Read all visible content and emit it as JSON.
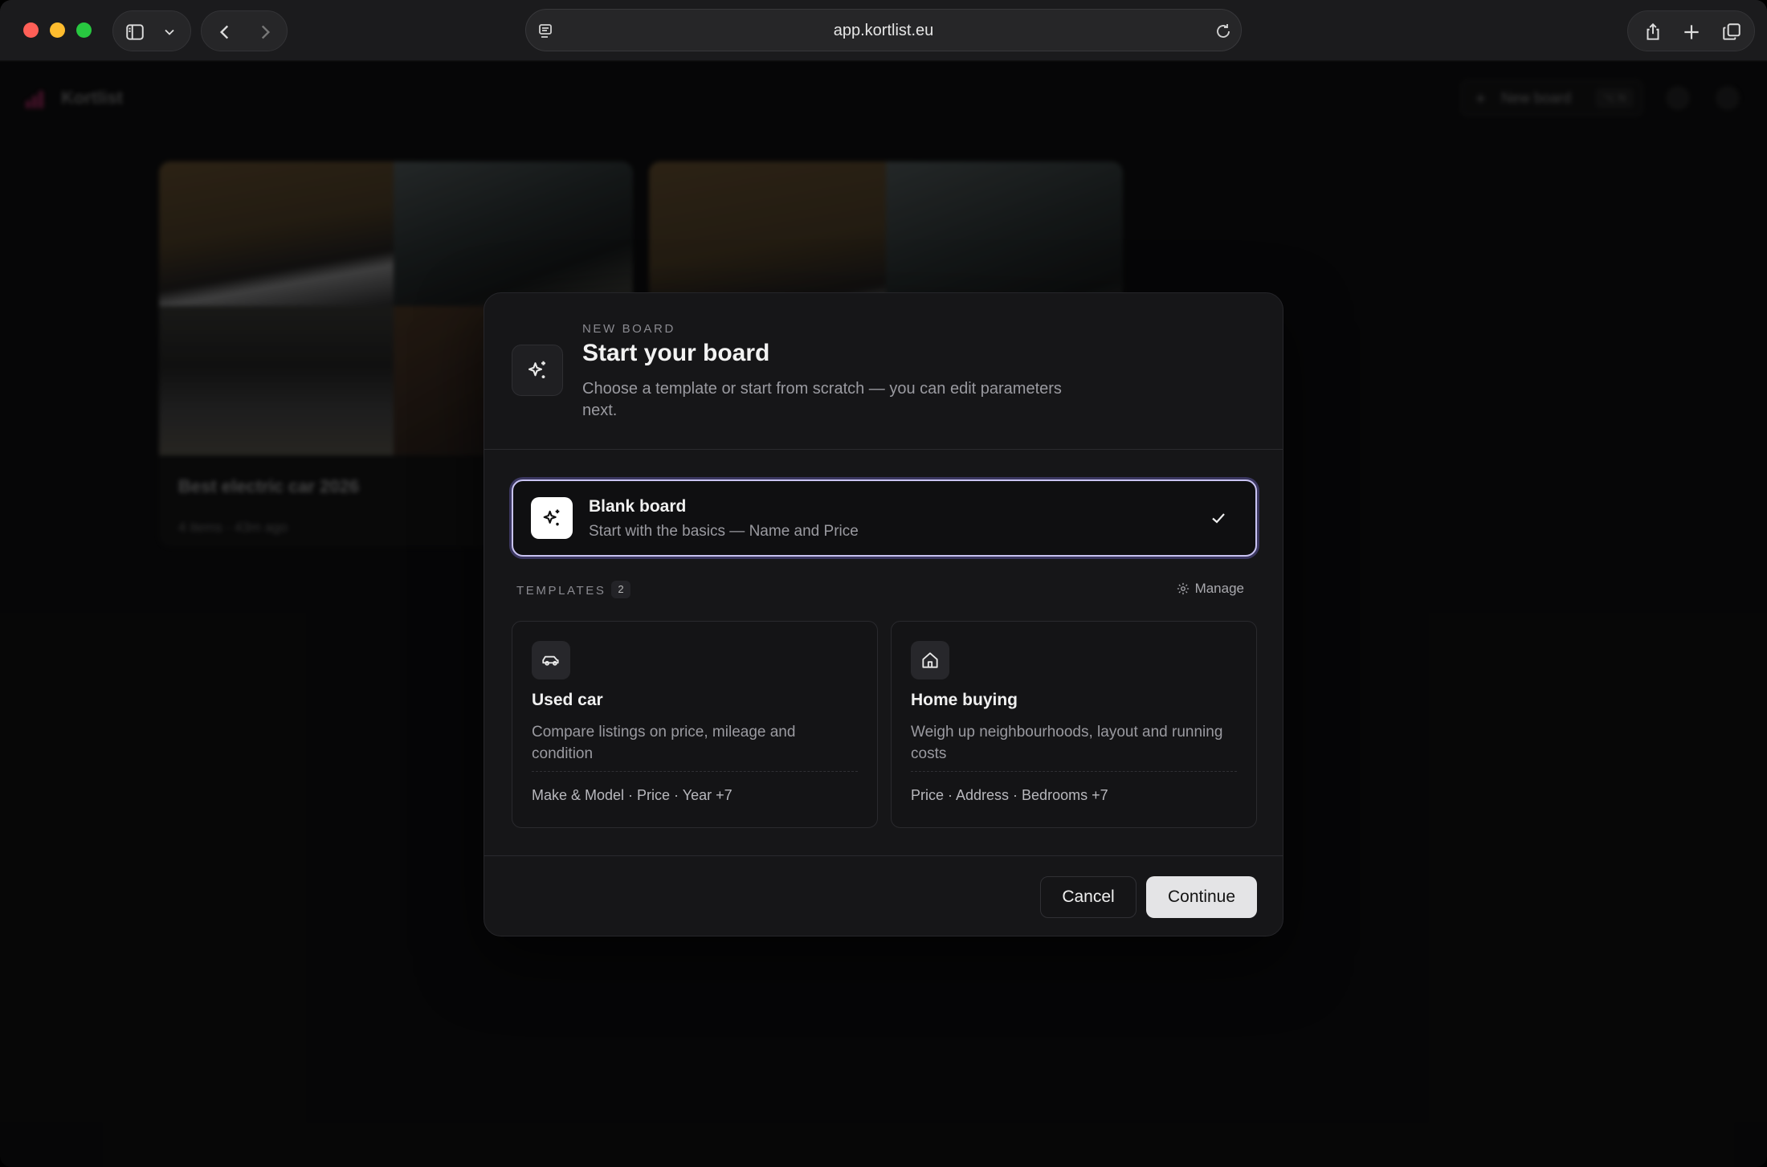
{
  "browser": {
    "url": "app.kortlist.eu",
    "icons": [
      "sidebar-icon",
      "chevron-down-icon",
      "back-icon",
      "forward-icon",
      "reader-icon",
      "reload-icon",
      "share-icon",
      "new-tab-icon",
      "tabs-overview-icon"
    ]
  },
  "background": {
    "brand": "Kortlist",
    "new_board_label": "New board",
    "new_board_shortcut": "⌥ N",
    "cards": [
      {
        "title": "Best electric car 2026",
        "meta": "4 items · 43m ago"
      }
    ]
  },
  "modal": {
    "eyebrow": "NEW BOARD",
    "title": "Start your board",
    "subtitle": "Choose a template or start from scratch — you can edit parameters next.",
    "blank": {
      "title": "Blank board",
      "subtitle": "Start with the basics — Name and Price",
      "selected": true
    },
    "templates_label": "TEMPLATES",
    "templates_count": "2",
    "manage_label": "Manage",
    "templates": [
      {
        "icon": "car-icon",
        "title": "Used car",
        "description": "Compare listings on price, mileage and condition",
        "fields": "Make & Model · Price · Year +7"
      },
      {
        "icon": "home-icon",
        "title": "Home buying",
        "description": "Weigh up neighbourhoods, layout and running costs",
        "fields": "Price · Address · Bedrooms +7"
      }
    ],
    "cancel_label": "Cancel",
    "continue_label": "Continue"
  },
  "colors": {
    "selected_border": "#c9c3f2",
    "brand_accent": "#d6307a",
    "continue_bg": "#e4e4e6"
  }
}
